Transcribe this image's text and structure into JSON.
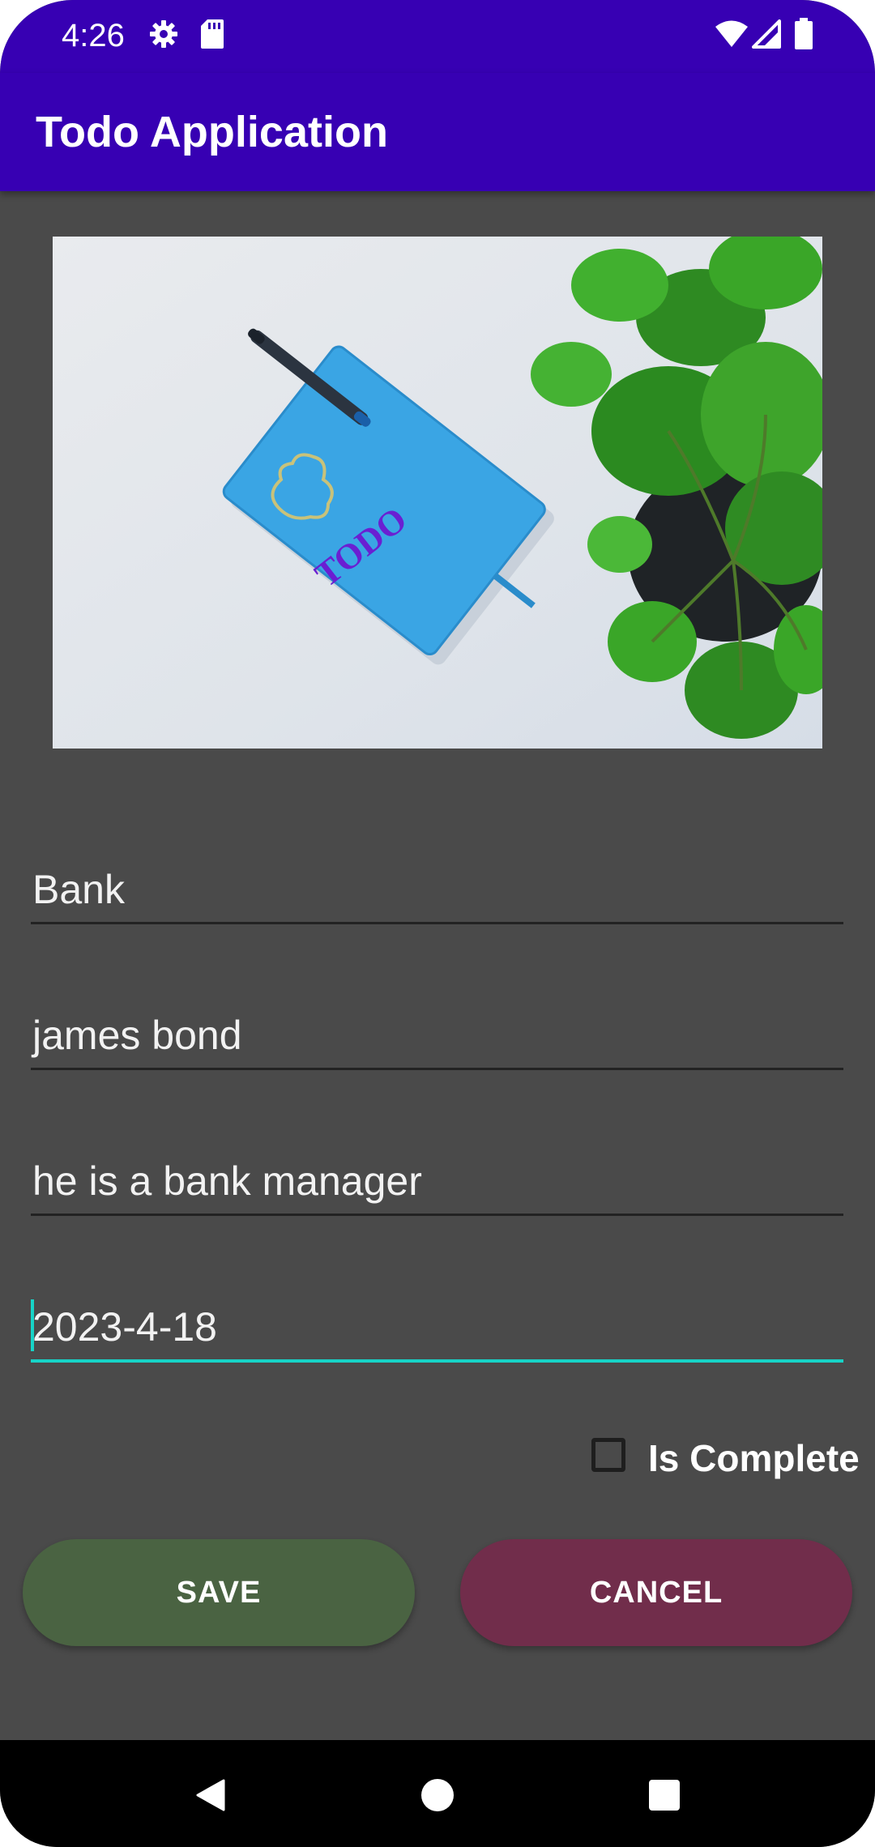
{
  "status_bar": {
    "time": "4:26",
    "icons": [
      "gear-icon",
      "sd-card-icon",
      "wifi-icon",
      "signal-icon",
      "battery-icon"
    ]
  },
  "app_bar": {
    "title": "Todo Application",
    "color": "#3700b3"
  },
  "hero_image": {
    "notebook_text": "TODO"
  },
  "form": {
    "fields": [
      {
        "value": "Bank"
      },
      {
        "value": "james bond"
      },
      {
        "value": "he is a bank manager"
      },
      {
        "value": "2023-4-18",
        "focused": true
      }
    ],
    "is_complete": {
      "label": "Is Complete",
      "checked": false
    }
  },
  "buttons": {
    "save_label": "SAVE",
    "save_color": "#4a6342",
    "cancel_label": "CANCEL",
    "cancel_color": "#712d4b"
  },
  "nav_bar": {
    "icons": [
      "back-icon",
      "home-icon",
      "recents-icon"
    ]
  },
  "colors": {
    "background": "#4a4a4a",
    "accent": "#17d3c7"
  }
}
